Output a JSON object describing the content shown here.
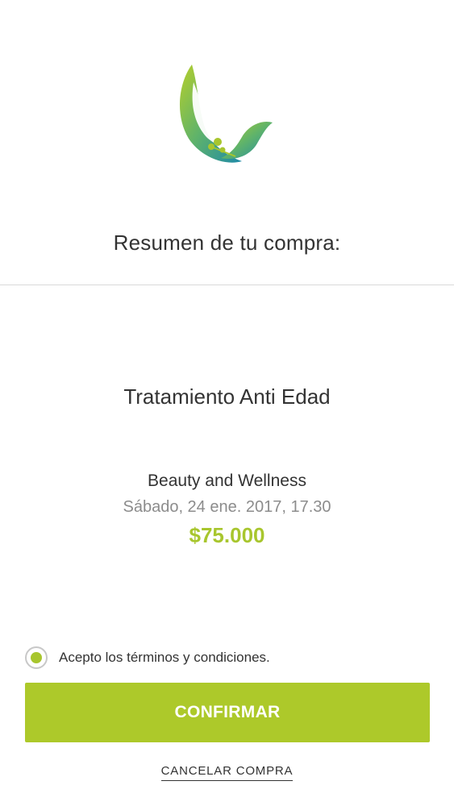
{
  "header": {
    "logo_icon": "leaf-bird-logo-icon",
    "title": "Resumen de tu compra:"
  },
  "summary": {
    "service": "Tratamiento Anti Edad",
    "venue": "Beauty and Wellness",
    "datetime": "Sábado, 24 ene. 2017, 17.30",
    "price": "$75.000"
  },
  "terms": {
    "label": "Acepto los términos y condiciones.",
    "checked": true
  },
  "actions": {
    "confirm_label": "CONFIRMAR",
    "cancel_label": "CANCELAR COMPRA"
  },
  "colors": {
    "accent_green": "#adc92a",
    "logo_gradient_start": "#b5cf2b",
    "logo_gradient_end": "#1e8aa8"
  }
}
